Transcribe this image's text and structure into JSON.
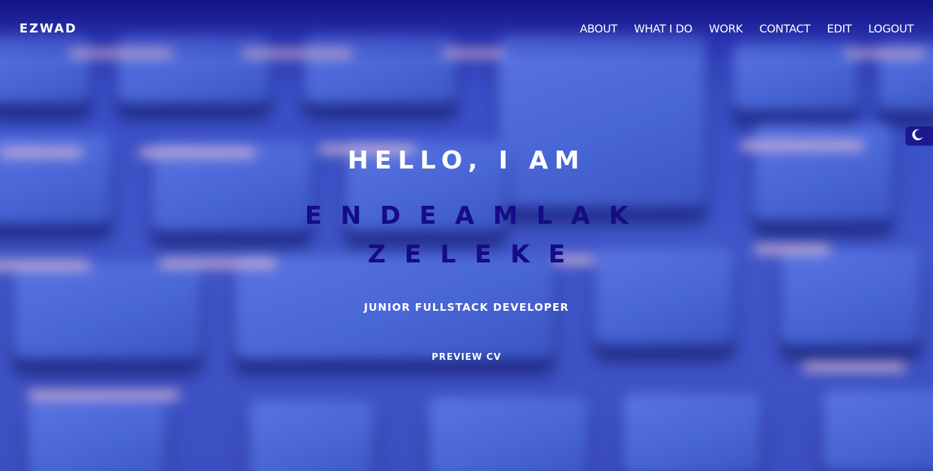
{
  "nav": {
    "brand": "EZWAD",
    "links": [
      {
        "label": "ABOUT"
      },
      {
        "label": "WHAT I DO"
      },
      {
        "label": "WORK"
      },
      {
        "label": "CONTACT"
      },
      {
        "label": "EDIT"
      },
      {
        "label": "LOGOUT"
      }
    ]
  },
  "hero": {
    "greeting": "HELLO, I AM",
    "name_first": "ENDEAMLAK",
    "name_last": "ZELEKE",
    "role": "JUNIOR FULLSTACK DEVELOPER",
    "cta_label": "PREVIEW CV"
  },
  "theme_toggle": {
    "icon": "moon-icon"
  },
  "colors": {
    "name_accent": "#150c86",
    "nav_text": "#ffffff",
    "toggle_bg": "#1b1a8c",
    "background_blue": "#4056c9"
  }
}
